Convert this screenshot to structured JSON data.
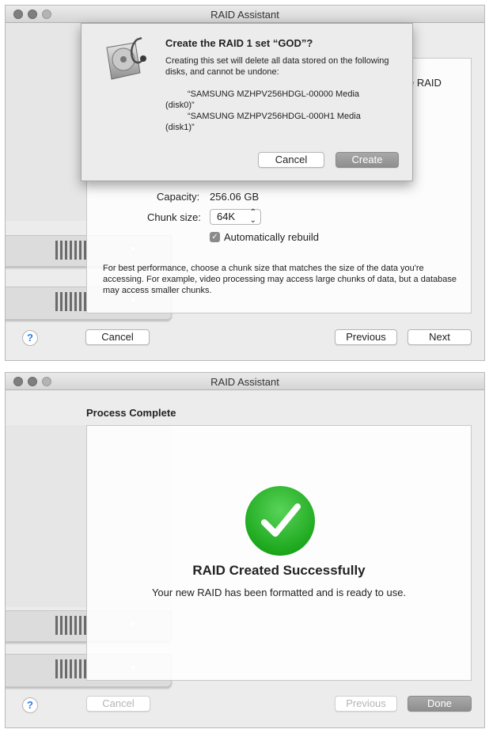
{
  "window1": {
    "title": "RAID Assistant",
    "partial_label": "e RAID",
    "capacity_label": "Capacity:",
    "capacity_value": "256.06 GB",
    "chunk_label": "Chunk size:",
    "chunk_value": "64K",
    "rebuild_label": "Automatically rebuild",
    "hint": "For best performance, choose a chunk size that matches the size of the data you're accessing. For example, video processing may access large chunks of data, but a database may access smaller chunks.",
    "help_label": "?",
    "cancel_label": "Cancel",
    "previous_label": "Previous",
    "next_label": "Next",
    "sheet": {
      "heading": "Create the RAID 1 set “GOD”?",
      "message": "Creating this set will delete all data stored on the following disks, and cannot be undone:",
      "disk1_line1": "“SAMSUNG MZHPV256HDGL-00000 Media",
      "disk1_line2": "(disk0)”",
      "disk2_line1": "“SAMSUNG MZHPV256HDGL-000H1 Media",
      "disk2_line2": "(disk1)”",
      "cancel_label": "Cancel",
      "create_label": "Create"
    }
  },
  "window2": {
    "title": "RAID Assistant",
    "section_title": "Process Complete",
    "success_title": "RAID Created Successfully",
    "success_message": "Your new RAID has been formatted and is ready to use.",
    "help_label": "?",
    "cancel_label": "Cancel",
    "previous_label": "Previous",
    "done_label": "Done"
  },
  "colors": {
    "success_green": "#2bbf2b",
    "help_blue": "#2b7de9",
    "default_button_gray": "#9a9a9a"
  },
  "icons": [
    "disk-utility-icon",
    "checkmark-icon",
    "chevron-updown-icon",
    "checkbox-checked-icon"
  ]
}
